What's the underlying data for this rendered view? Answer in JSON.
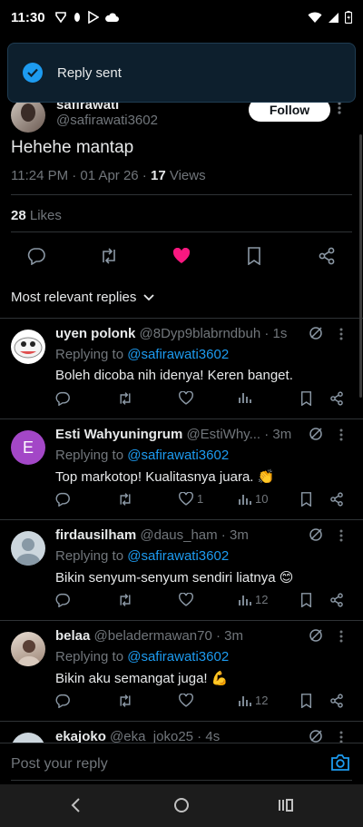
{
  "status_bar": {
    "time": "11:30"
  },
  "toast": {
    "text": "Reply sent"
  },
  "author": {
    "name": "safirawati",
    "handle": "@safirawati3602",
    "follow_label": "Follow"
  },
  "tweet": {
    "text": "Hehehe mantap",
    "time": "11:24 PM · 01 Apr 26 · ",
    "views_count": "17",
    "views_label": " Views",
    "likes_count": "28",
    "likes_label": " Likes"
  },
  "sort": {
    "label": "Most relevant replies"
  },
  "replies": [
    {
      "name": "uyen polonk",
      "handle": "@8Dyp9blabrndbuh",
      "time": " · 1s",
      "replying_prefix": "Replying to ",
      "replying_to": "@safirawati3602",
      "text": "Boleh dicoba nih idenya! Keren banget.",
      "likes": "",
      "views": ""
    },
    {
      "name": "Esti Wahyuningrum",
      "handle": "@EstiWhy...",
      "time": " · 3m",
      "replying_prefix": "Replying to ",
      "replying_to": "@safirawati3602",
      "text": "Top markotop! Kualitasnya juara. 👏",
      "likes": "1",
      "views": "10",
      "avatar_letter": "E"
    },
    {
      "name": "firdausilham",
      "handle": "@daus_ham",
      "time": " · 3m",
      "replying_prefix": "Replying to ",
      "replying_to": "@safirawati3602",
      "text": "Bikin senyum-senyum sendiri liatnya 😊",
      "likes": "",
      "views": "12"
    },
    {
      "name": "belaa",
      "handle": "@beladermawan70",
      "time": " · 3m",
      "replying_prefix": "Replying to ",
      "replying_to": "@safirawati3602",
      "text": "Bikin aku semangat juga! 💪",
      "likes": "",
      "views": "12"
    },
    {
      "name": "ekajoko",
      "handle": "@eka_joko25",
      "time": " · 4s",
      "replying_prefix": "",
      "replying_to": "",
      "text": "",
      "likes": "",
      "views": ""
    }
  ],
  "compose": {
    "placeholder": "Post your reply"
  },
  "colors": {
    "accent": "#1d9bf0",
    "like": "#f91880",
    "background": "#000000",
    "toast_bg": "#0d1f2d"
  },
  "icons": [
    "tor-icon",
    "vpn-key-icon",
    "play-store-icon",
    "cloud-icon",
    "wifi-icon",
    "signal-icon",
    "battery-icon",
    "check-icon",
    "more-icon",
    "reply-icon",
    "retweet-icon",
    "heart-icon",
    "bookmark-icon",
    "share-icon",
    "chevron-down-icon",
    "grok-icon",
    "views-icon",
    "camera-icon",
    "back-icon",
    "home-icon",
    "recents-icon"
  ]
}
